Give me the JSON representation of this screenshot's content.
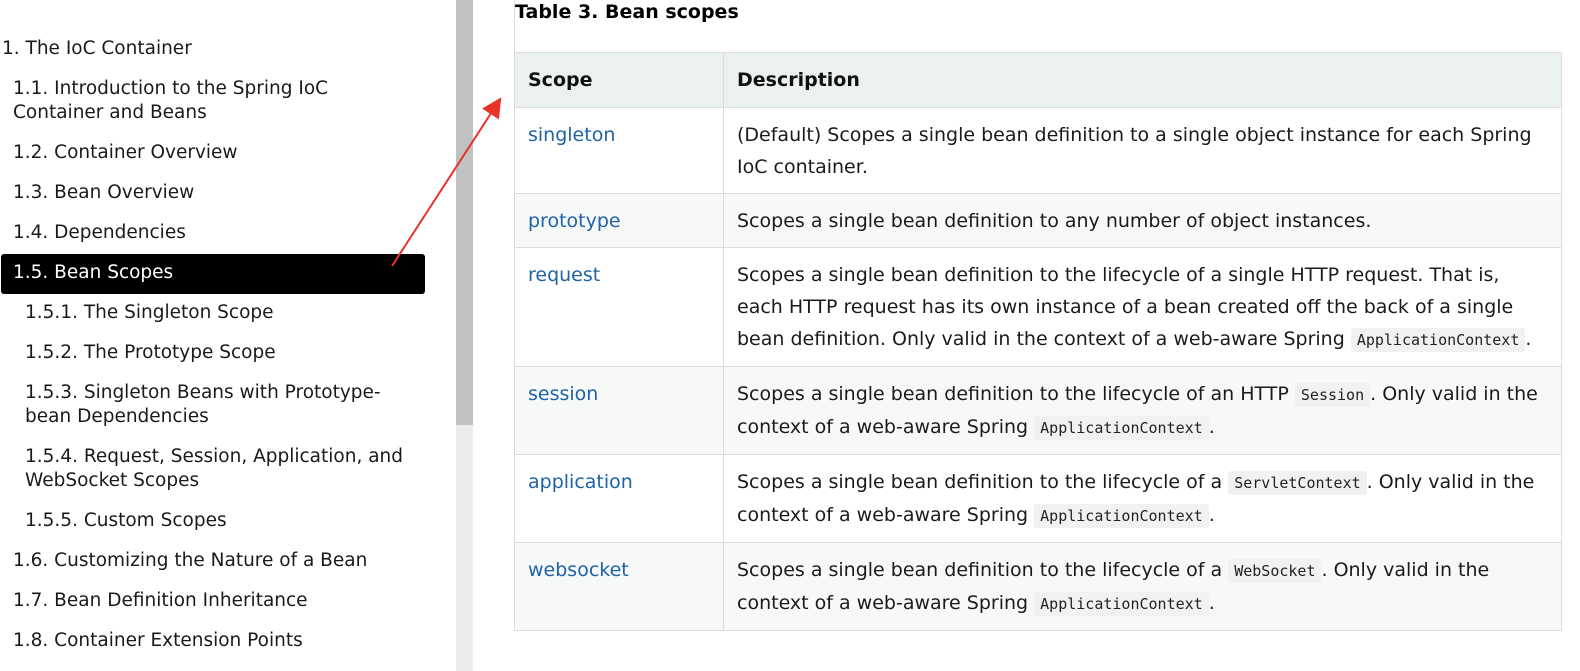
{
  "toc": {
    "items": [
      {
        "label": "1. The IoC Container",
        "level": 1
      },
      {
        "label": "1.1. Introduction to the Spring IoC Container and Beans",
        "level": 2
      },
      {
        "label": "1.2. Container Overview",
        "level": 2
      },
      {
        "label": "1.3. Bean Overview",
        "level": 2
      },
      {
        "label": "1.4. Dependencies",
        "level": 2
      },
      {
        "label": "1.5. Bean Scopes",
        "level": 2,
        "active": true
      },
      {
        "label": "1.5.1. The Singleton Scope",
        "level": 3
      },
      {
        "label": "1.5.2. The Prototype Scope",
        "level": 3
      },
      {
        "label": "1.5.3. Singleton Beans with Prototype-bean Dependencies",
        "level": 3
      },
      {
        "label": "1.5.4. Request, Session, Application, and WebSocket Scopes",
        "level": 3
      },
      {
        "label": "1.5.5. Custom Scopes",
        "level": 3
      },
      {
        "label": "1.6. Customizing the Nature of a Bean",
        "level": 2
      },
      {
        "label": "1.7. Bean Definition Inheritance",
        "level": 2
      },
      {
        "label": "1.8. Container Extension Points",
        "level": 2
      }
    ]
  },
  "table": {
    "caption": "Table 3. Bean scopes",
    "headers": {
      "scope": "Scope",
      "description": "Description"
    },
    "rows": [
      {
        "scope": "singleton",
        "parts": [
          {
            "t": "(Default) Scopes a single bean definition to a single object instance for each Spring IoC container."
          }
        ]
      },
      {
        "scope": "prototype",
        "parts": [
          {
            "t": "Scopes a single bean definition to any number of object instances."
          }
        ]
      },
      {
        "scope": "request",
        "parts": [
          {
            "t": "Scopes a single bean definition to the lifecycle of a single HTTP request. That is, each HTTP request has its own instance of a bean created off the back of a single bean definition. Only valid in the context of a web-aware Spring "
          },
          {
            "code": "ApplicationContext"
          },
          {
            "t": "."
          }
        ]
      },
      {
        "scope": "session",
        "parts": [
          {
            "t": "Scopes a single bean definition to the lifecycle of an HTTP "
          },
          {
            "code": "Session"
          },
          {
            "t": ". Only valid in the context of a web-aware Spring "
          },
          {
            "code": "ApplicationContext"
          },
          {
            "t": "."
          }
        ]
      },
      {
        "scope": "application",
        "parts": [
          {
            "t": "Scopes a single bean definition to the lifecycle of a "
          },
          {
            "code": "ServletContext"
          },
          {
            "t": ". Only valid in the context of a web-aware Spring "
          },
          {
            "code": "ApplicationContext"
          },
          {
            "t": "."
          }
        ]
      },
      {
        "scope": "websocket",
        "parts": [
          {
            "t": "Scopes a single bean definition to the lifecycle of a "
          },
          {
            "code": "WebSocket"
          },
          {
            "t": ". Only valid in the context of a web-aware Spring "
          },
          {
            "code": "ApplicationContext"
          },
          {
            "t": "."
          }
        ]
      }
    ]
  },
  "colors": {
    "link": "#1e62a8",
    "active_bg": "#000000",
    "header_bg": "#ebf1f1",
    "arrow": "#e8332a"
  }
}
